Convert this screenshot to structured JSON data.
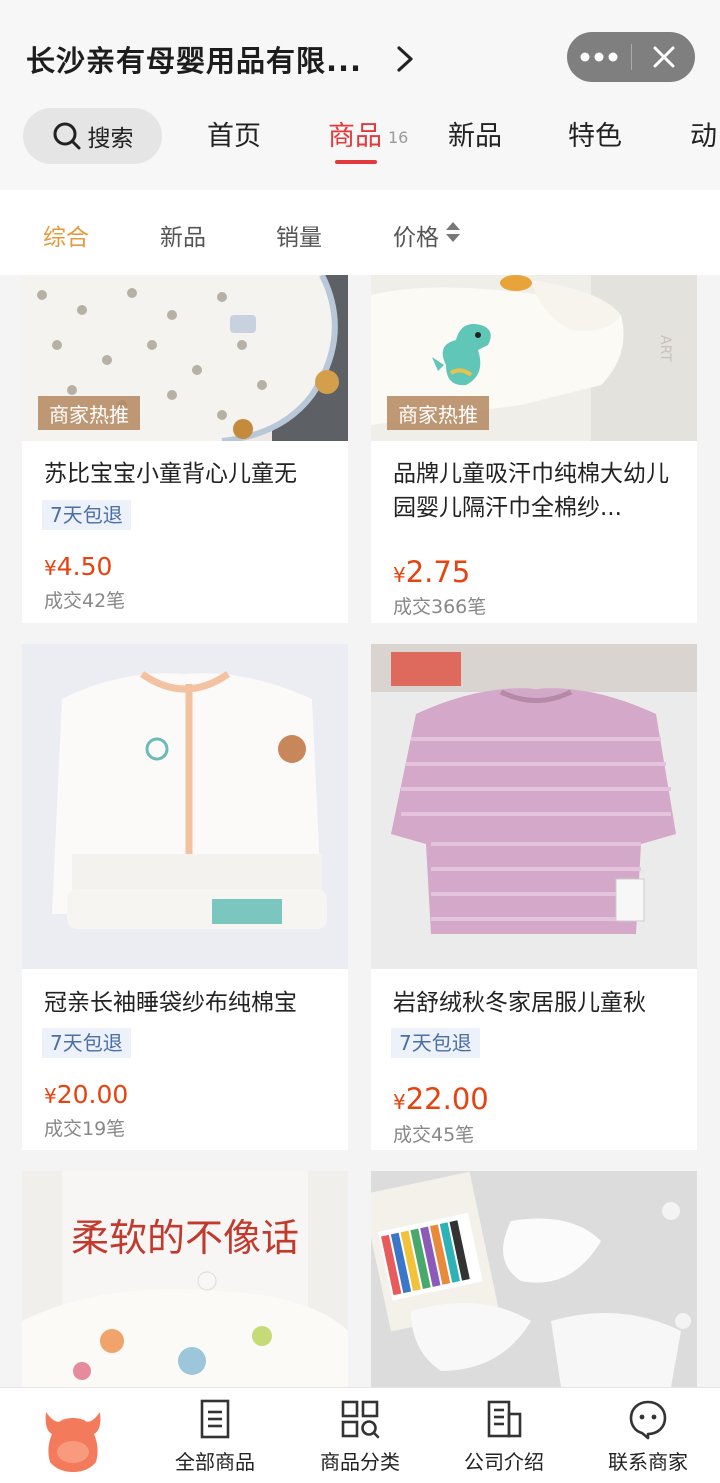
{
  "header": {
    "shop_title": "长沙亲有母婴用品有限...",
    "search_label": "搜索",
    "tabs": [
      {
        "label": "首页"
      },
      {
        "label": "商品",
        "count": "16"
      },
      {
        "label": "新品"
      },
      {
        "label": "特色"
      },
      {
        "label": "动"
      }
    ],
    "icons": {
      "more": "more-dots-icon",
      "close": "close-icon",
      "search": "search-icon",
      "chevron": "chevron-right-icon"
    }
  },
  "filters": [
    {
      "label": "综合"
    },
    {
      "label": "新品"
    },
    {
      "label": "销量"
    },
    {
      "label": "价格"
    }
  ],
  "colors": {
    "accent_red": "#e4393c",
    "filter_active": "#e59a3c",
    "price": "#e8420f",
    "return_badge_text": "#4a6fa5"
  },
  "products": [
    {
      "badge": "商家热推",
      "title": "苏比宝宝小童背心儿童无",
      "return_tag": "7天包退",
      "currency": "¥",
      "price": "4.50",
      "sold": "成交42笔"
    },
    {
      "badge": "商家热推",
      "title": "品牌儿童吸汗巾纯棉大幼儿园婴儿隔汗巾全棉纱...",
      "currency": "¥",
      "price": "2.75",
      "sold": "成交366笔"
    },
    {
      "title": "冠亲长袖睡袋纱布纯棉宝",
      "return_tag": "7天包退",
      "currency": "¥",
      "price": "20.00",
      "sold": "成交19笔"
    },
    {
      "title": "岩舒绒秋冬家居服儿童秋",
      "return_tag": "7天包退",
      "currency": "¥",
      "price": "22.00",
      "sold": "成交45笔"
    },
    {
      "image_text": "柔软的不像话"
    },
    {}
  ],
  "bottom_nav": [
    {
      "label": "全部商品",
      "icon": "list-doc-icon"
    },
    {
      "label": "商品分类",
      "icon": "category-grid-icon"
    },
    {
      "label": "公司介绍",
      "icon": "company-building-icon"
    },
    {
      "label": "联系商家",
      "icon": "chat-bubble-icon"
    }
  ]
}
